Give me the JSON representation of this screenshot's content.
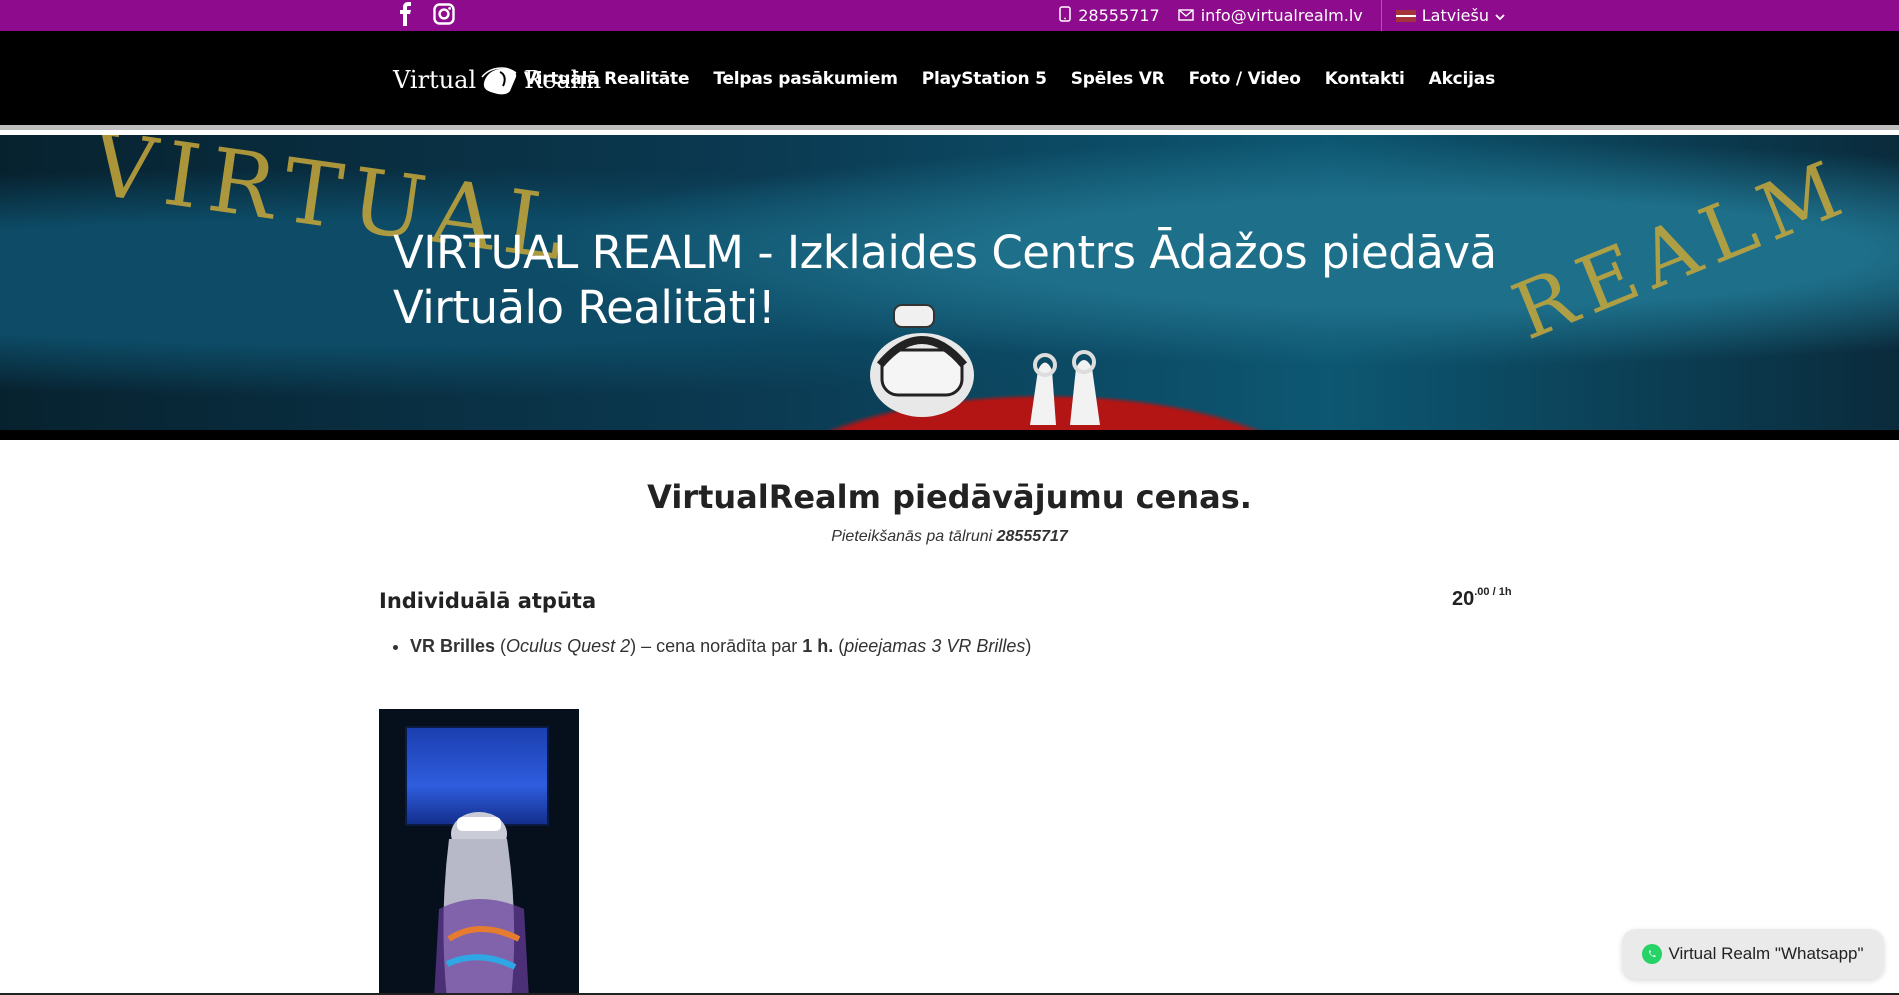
{
  "topbar": {
    "phone": "28555717",
    "email": "info@virtualrealm.lv",
    "language": "Latviešu",
    "social": [
      "facebook-icon",
      "instagram-icon"
    ]
  },
  "logo": {
    "left": "Virtual",
    "right": "Realm"
  },
  "nav": {
    "items": [
      "Virtuālā Realitāte",
      "Telpas pasākumiem",
      "PlayStation 5",
      "Spēles VR",
      "Foto / Video",
      "Kontakti",
      "Akcijas"
    ]
  },
  "hero": {
    "title": "VIRTUAL REALM - Izklaides Centrs Ādažos piedāvā Virtuālo Realitāti!",
    "graffiti_left": "VIRTUAL",
    "graffiti_right": "REALM"
  },
  "main": {
    "section_title": "VirtualRealm piedāvājumu cenas.",
    "subtitle_text": "Pieteikšanās pa tālruni",
    "subtitle_phone": "28555717",
    "offer": {
      "title": "Individuālā atpūta",
      "price_main": "20",
      "price_sup": ".00 / 1h",
      "item_bold": "VR Brilles",
      "item_device": "Oculus Quest 2",
      "item_text": "– cena norādīta par",
      "item_duration": "1 h.",
      "item_note": "pieejamas 3 VR Brilles"
    }
  },
  "whatsapp": {
    "label": "Virtual Realm \"Whatsapp\""
  },
  "colors": {
    "topbar": "#8e0b8e",
    "navbar": "#000000",
    "graffiti": "#c8a83a",
    "whatsapp": "#25d366"
  }
}
